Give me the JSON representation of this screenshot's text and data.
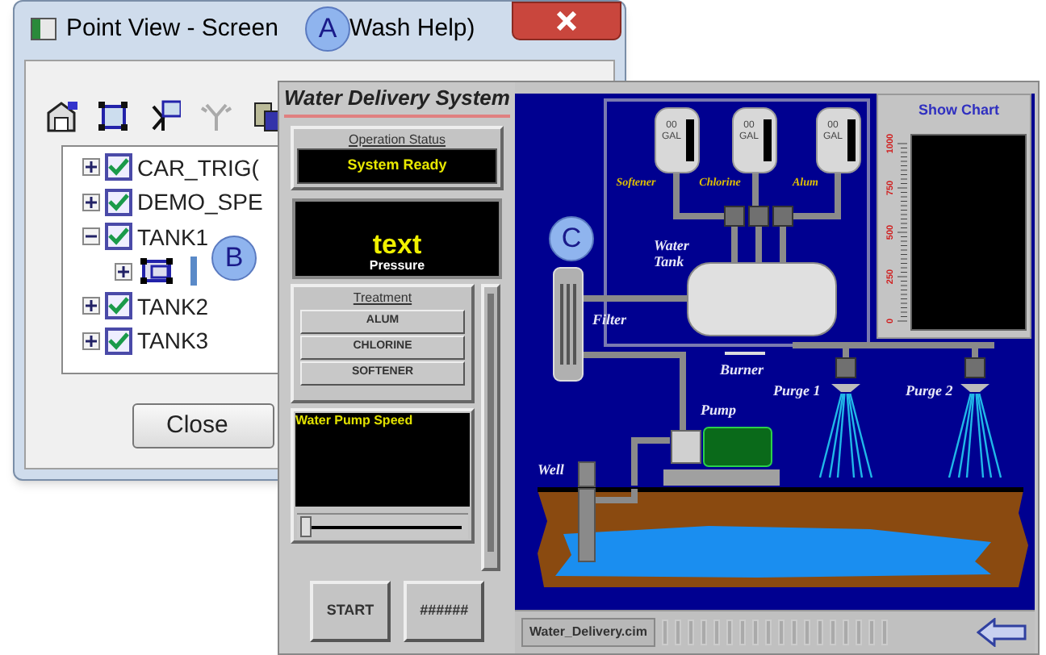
{
  "dialog": {
    "title_start": "Point View - Screen",
    "title_end": "Wash Help)",
    "close_button": "Close",
    "tree": [
      {
        "label": "CAR_TRIG(",
        "checked": true,
        "expanded": false
      },
      {
        "label": "DEMO_SPE",
        "checked": true,
        "expanded": false
      },
      {
        "label": "TANK1",
        "checked": true,
        "expanded": true,
        "children": [
          {
            "kind": "screen"
          }
        ]
      },
      {
        "label": "TANK2",
        "checked": true,
        "expanded": false
      },
      {
        "label": "TANK3",
        "checked": true,
        "expanded": false
      }
    ]
  },
  "callouts": [
    "A",
    "B",
    "C"
  ],
  "panel": {
    "title": "Water Delivery System",
    "status_label": "Operation Status",
    "status_value": "System Ready",
    "pressure_value": "text",
    "pressure_label": "Pressure",
    "treatment_label": "Treatment",
    "treatment_buttons": [
      "ALUM",
      "CHLORINE",
      "SOFTENER"
    ],
    "pump_speed_label": "Water Pump Speed",
    "pump_speed": {
      "level": 0
    },
    "buttons": [
      "START",
      "######"
    ]
  },
  "canvas": {
    "tanks": [
      {
        "label": "Softener",
        "value": "00",
        "unit": "GAL"
      },
      {
        "label": "Chlorine",
        "value": "00",
        "unit": "GAL"
      },
      {
        "label": "Alum",
        "value": "00",
        "unit": "GAL"
      }
    ],
    "labels": {
      "water_tank": "Water Tank",
      "filter": "Filter",
      "burner": "Burner",
      "pump": "Pump",
      "well": "Well",
      "purge_1": "Purge 1",
      "purge_2": "Purge 2"
    },
    "chart": {
      "button": "Show Chart",
      "scale": [
        "0",
        "250",
        "500",
        "750",
        "1000"
      ]
    }
  },
  "status_bar": {
    "file": "Water_Delivery.cim"
  }
}
